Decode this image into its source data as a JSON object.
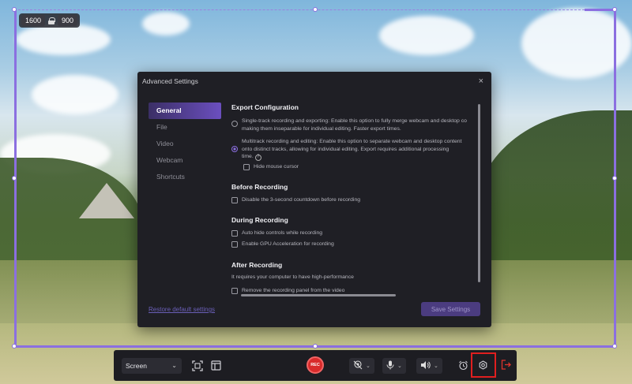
{
  "selection": {
    "width": "1600",
    "height": "900"
  },
  "dialog": {
    "title": "Advanced Settings",
    "close": "×",
    "nav": [
      "General",
      "File",
      "Video",
      "Webcam",
      "Shortcuts"
    ],
    "active_nav": "General",
    "restore_label": "Restore default settings",
    "save_label": "Save Settings",
    "export": {
      "title": "Export Configuration",
      "single_text": "Single-track recording and exporting: Enable this option to fully merge webcam and desktop co",
      "single_text2": "making them inseparable for individual editing. Faster export times.",
      "multi_text": "Multitrack recording and editing: Enable this option to separate webcam and desktop content",
      "multi_text2": "onto distinct tracks, allowing for individual editing. Export requires additional processing",
      "multi_text3": "time.",
      "help": "?",
      "hide_cursor": "Hide mouse cursor"
    },
    "before": {
      "title": "Before Recording",
      "countdown": "Disable the 3-second countdown before recording"
    },
    "during": {
      "title": "During Recording",
      "auto_hide": "Auto hide controls while recording",
      "gpu": "Enable GPU Acceleration for recording"
    },
    "after": {
      "title": "After Recording",
      "note": "It requires your computer to have high-performance",
      "remove_panel": "Remove the recording panel from the video"
    }
  },
  "toolbar": {
    "mode": "Screen",
    "rec_label": "REC"
  },
  "colors": {
    "accent": "#8b6fe0",
    "record": "#d92b2b",
    "highlight": "#e01f1f"
  }
}
